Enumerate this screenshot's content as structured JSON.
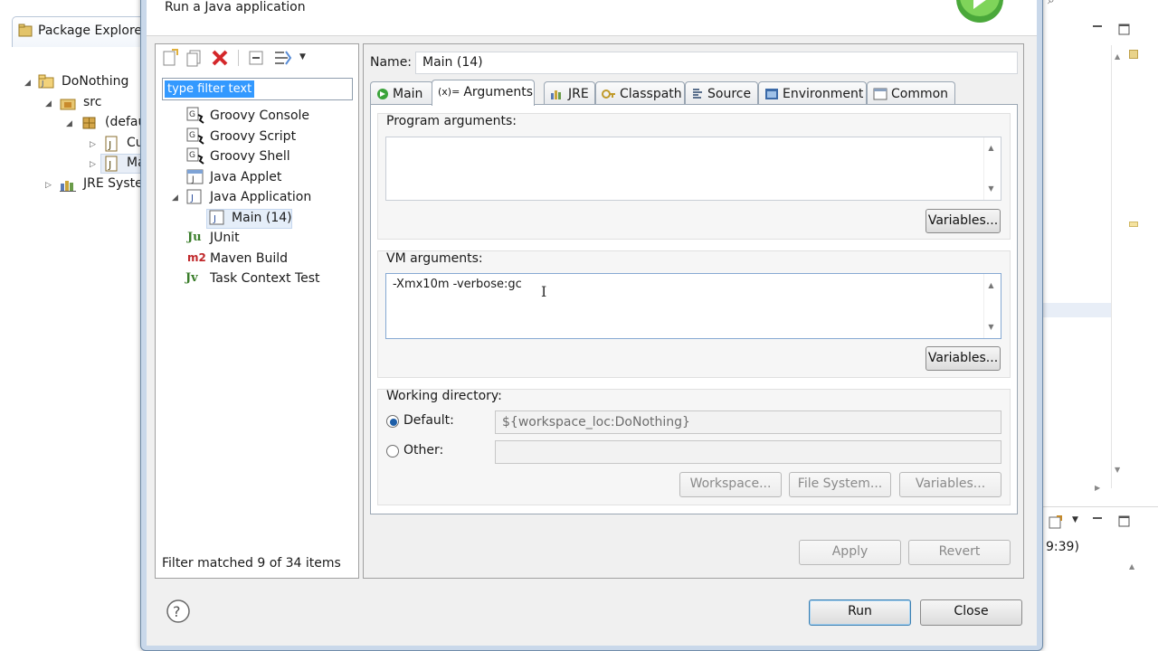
{
  "dialog": {
    "header_text": "Run a Java application"
  },
  "background": {
    "package_explorer_tab": "Package Explorer",
    "tree": [
      {
        "label": "DoNothing"
      },
      {
        "label": "src"
      },
      {
        "label": "(defau"
      },
      {
        "label": "Cu"
      },
      {
        "label": "Ma"
      },
      {
        "label": "JRE System"
      }
    ],
    "right_partial_text": "9:39)"
  },
  "left": {
    "filter_placeholder": "type filter text",
    "items": [
      {
        "label": "Groovy Console"
      },
      {
        "label": "Groovy Script"
      },
      {
        "label": "Groovy Shell"
      },
      {
        "label": "Java Applet"
      },
      {
        "label": "Java Application"
      },
      {
        "label": "Main (14)"
      },
      {
        "label": "JUnit"
      },
      {
        "label": "Maven Build"
      },
      {
        "label": "Task Context Test"
      }
    ],
    "filter_status": "Filter matched 9 of 34 items"
  },
  "config": {
    "name_label": "Name:",
    "name_value": "Main (14)",
    "tabs": [
      {
        "label": "Main"
      },
      {
        "label": "Arguments"
      },
      {
        "label": "JRE"
      },
      {
        "label": "Classpath"
      },
      {
        "label": "Source"
      },
      {
        "label": "Environment"
      },
      {
        "label": "Common"
      }
    ],
    "active_tab": "Arguments",
    "program_args_label": "Program arguments:",
    "program_args_value": "",
    "vm_args_label": "VM arguments:",
    "vm_args_value": "-Xmx10m -verbose:gc",
    "variables_label": "Variables...",
    "working_dir": {
      "label": "Working directory:",
      "default_label": "Default:",
      "default_value": "${workspace_loc:DoNothing}",
      "other_label": "Other:",
      "other_value": "",
      "selected": "Default",
      "workspace_btn": "Workspace...",
      "filesystem_btn": "File System...",
      "variables_btn": "Variables..."
    },
    "apply_label": "Apply",
    "revert_label": "Revert"
  },
  "footer": {
    "run_label": "Run",
    "close_label": "Close"
  },
  "colors": {
    "selection_blue": "#3399ff",
    "dialog_frame": "#c9d8ea",
    "disabled_text": "#8a8a8a"
  }
}
